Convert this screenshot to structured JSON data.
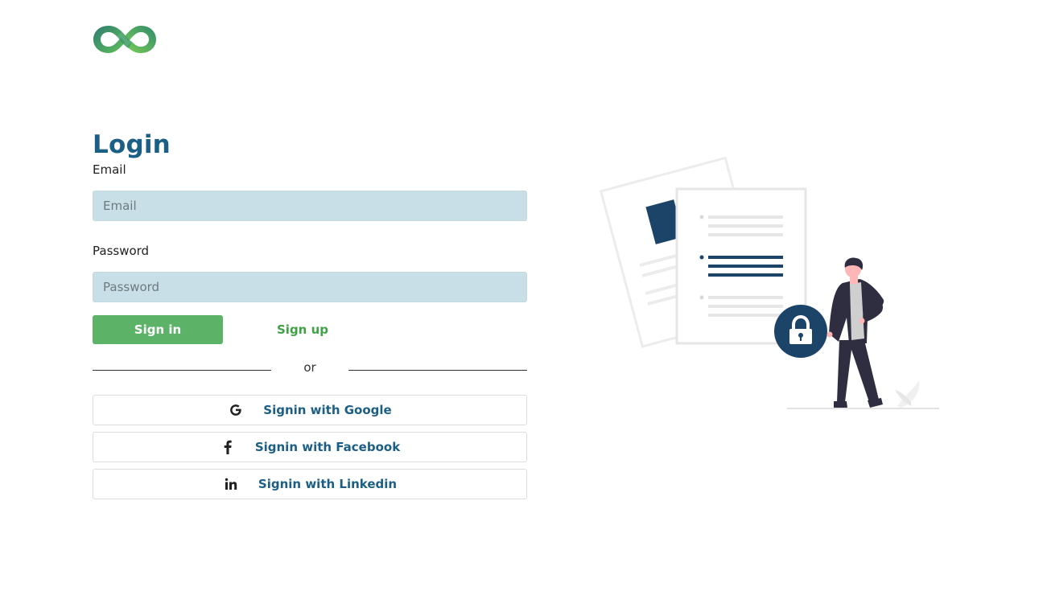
{
  "header": {
    "logo_icon": "infinity-logo-icon"
  },
  "login": {
    "title": "Login",
    "email_label": "Email",
    "email_placeholder": "Email",
    "email_value": "",
    "password_label": "Password",
    "password_placeholder": "Password",
    "password_value": "",
    "signin_label": "Sign in",
    "signup_label": "Sign up",
    "divider_text": "or"
  },
  "social": [
    {
      "icon": "google-icon",
      "label": "Signin with Google"
    },
    {
      "icon": "facebook-icon",
      "label": "Signin with Facebook"
    },
    {
      "icon": "linkedin-icon",
      "label": "Signin with Linkedin"
    }
  ],
  "colors": {
    "primary": "#1b5f86",
    "accent_green": "#5cb368",
    "signup_green": "#3ea244",
    "input_bg": "#c9dfe7",
    "illustration_navy": "#1b4468"
  },
  "illustration": {
    "icon": "secure-documents-illustration"
  }
}
